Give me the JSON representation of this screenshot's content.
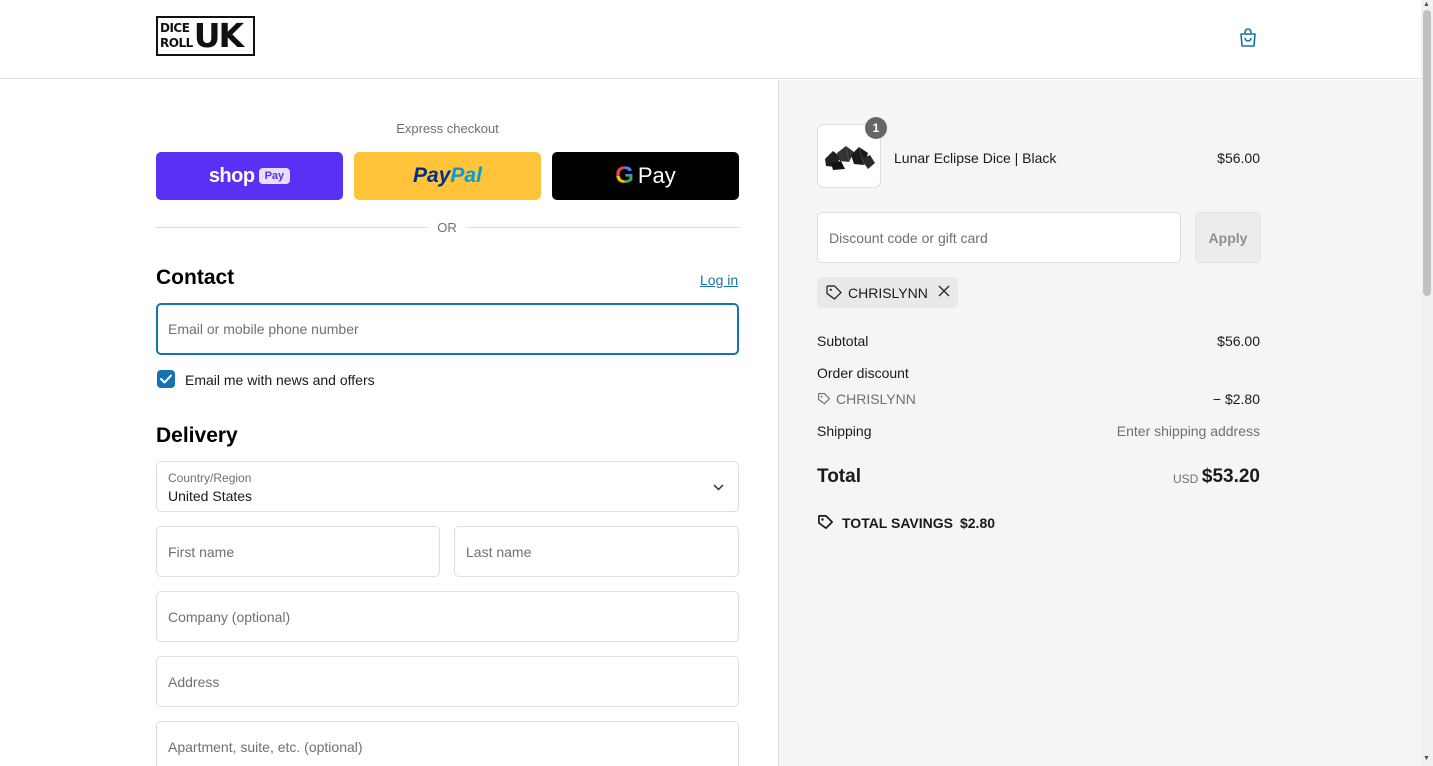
{
  "header": {
    "logo_top_line": "DICE",
    "logo_bottom_line": "ROLL",
    "logo_big": "UK"
  },
  "express": {
    "label": "Express checkout",
    "shop_pay": {
      "word": "shop",
      "badge": "Pay"
    },
    "paypal": {
      "part1": "Pay",
      "part2": "Pal"
    },
    "gpay": {
      "g": "G",
      "word": "Pay"
    },
    "or_text": "OR"
  },
  "contact": {
    "heading": "Contact",
    "login_link": "Log in",
    "email_placeholder": "Email or mobile phone number",
    "news_checkbox_label": "Email me with news and offers",
    "news_checked": true
  },
  "delivery": {
    "heading": "Delivery",
    "country_label": "Country/Region",
    "country_value": "United States",
    "first_name_placeholder": "First name",
    "last_name_placeholder": "Last name",
    "company_placeholder": "Company (optional)",
    "address_placeholder": "Address",
    "apartment_placeholder": "Apartment, suite, etc. (optional)"
  },
  "summary": {
    "item": {
      "name": "Lunar Eclipse Dice | Black",
      "price": "$56.00",
      "quantity": "1"
    },
    "discount_placeholder": "Discount code or gift card",
    "apply_label": "Apply",
    "applied_code": "CHRISLYNN",
    "subtotal_label": "Subtotal",
    "subtotal_value": "$56.00",
    "order_discount_label": "Order discount",
    "order_discount_code": "CHRISLYNN",
    "order_discount_value": "− $2.80",
    "shipping_label": "Shipping",
    "shipping_value": "Enter shipping address",
    "total_label": "Total",
    "currency": "USD",
    "total_value": "$53.20",
    "savings_label": "TOTAL SAVINGS",
    "savings_value": "$2.80"
  },
  "colors": {
    "accent": "#1773b0",
    "shop_pay": "#5a31f4",
    "paypal": "#ffc439",
    "gpay": "#000000",
    "summary_bg": "#f5f5f5"
  }
}
